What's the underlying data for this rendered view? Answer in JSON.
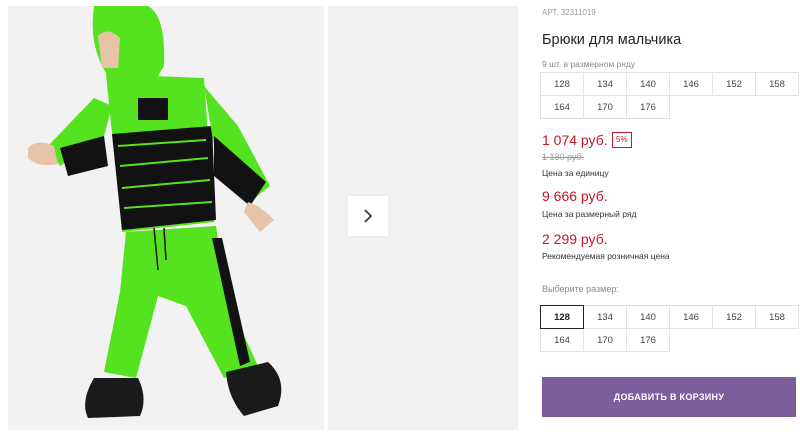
{
  "product": {
    "sku": "АРТ. 32311019",
    "title": "Брюки для мальчика",
    "pack_note": "9 шт. в размерном ряду"
  },
  "pack_sizes": [
    "128",
    "134",
    "140",
    "146",
    "152",
    "158",
    "164",
    "170",
    "176"
  ],
  "prices": {
    "unit_price": "1 074 руб.",
    "discount": "5%",
    "old_price": "1 130 руб.",
    "unit_label": "Цена за единицу",
    "pack_price": "9 666 руб.",
    "pack_label": "Цена за размерный ряд",
    "rrp_price": "2 299 руб.",
    "rrp_label": "Рекомендуемая розничная цена"
  },
  "size_picker": {
    "label": "Выберите размер:",
    "selected": "128",
    "sizes": [
      "128",
      "134",
      "140",
      "146",
      "152",
      "158",
      "164",
      "170",
      "176"
    ]
  },
  "cart_button": {
    "label": "ДОБАВИТЬ В КОРЗИНУ"
  },
  "colors": {
    "accent": "#7c5e9c",
    "price": "#c4162c",
    "garment": "#55e31f"
  }
}
